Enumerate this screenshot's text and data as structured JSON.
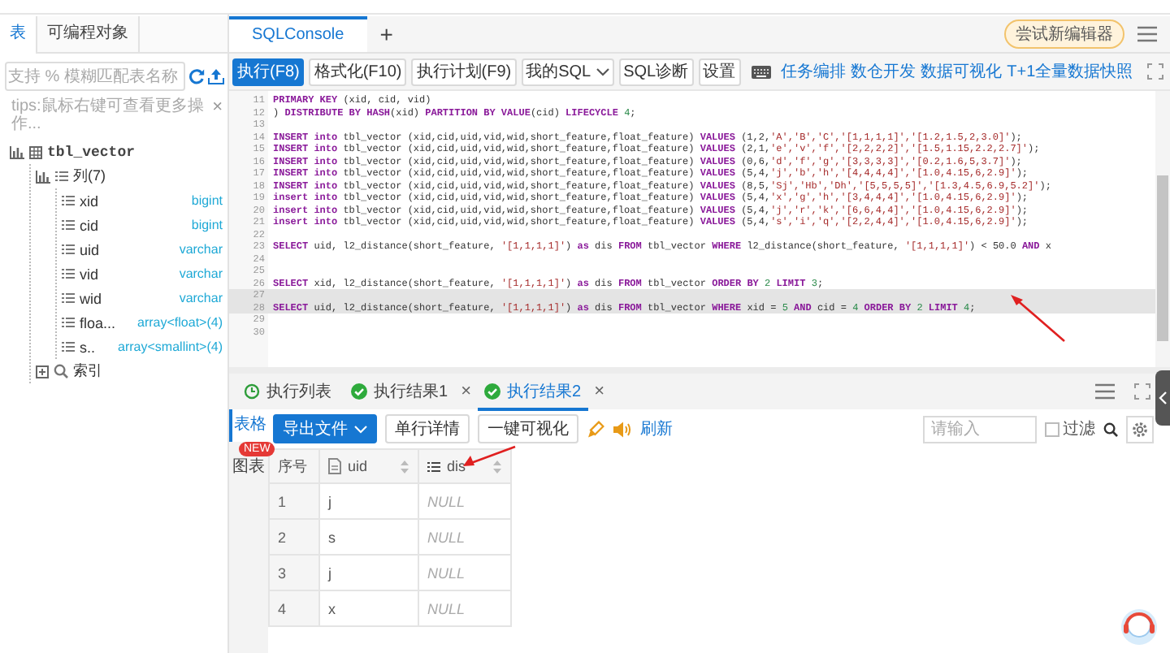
{
  "sidebar": {
    "tabs": [
      {
        "label": "表",
        "selected": true
      },
      {
        "label": "可编程对象",
        "selected": false
      }
    ],
    "search": {
      "placeholder": "支持 % 模糊匹配表名称"
    },
    "tip": "tips:鼠标右键可查看更多操作...",
    "tip_close": "×",
    "tree": [
      {
        "label": "tbl_vector",
        "kind": "table",
        "children": [
          {
            "label": "列(7)",
            "kind": "group",
            "children": [
              {
                "label": "xid",
                "type": "bigint",
                "kind": "column"
              },
              {
                "label": "cid",
                "type": "bigint",
                "kind": "column"
              },
              {
                "label": "uid",
                "type": "varchar",
                "kind": "column"
              },
              {
                "label": "vid",
                "type": "varchar",
                "kind": "column"
              },
              {
                "label": "wid",
                "type": "varchar",
                "kind": "column"
              },
              {
                "label": "floa...",
                "type": "array<float>(4)",
                "kind": "column"
              },
              {
                "label": "s..",
                "type": "array<smallint>(4)",
                "kind": "column"
              }
            ]
          },
          {
            "label": "索引",
            "kind": "index"
          }
        ]
      }
    ]
  },
  "console": {
    "tabs": [
      {
        "label": "SQLConsole",
        "selected": true
      }
    ],
    "add": "+",
    "try_button": "尝试新编辑器",
    "toolbar": [
      {
        "label": "执行(F8)",
        "kind": "primary"
      },
      {
        "label": "格式化(F10)",
        "kind": "button"
      },
      {
        "label": "执行计划(F9)",
        "kind": "button"
      },
      {
        "label": "我的SQL",
        "kind": "dropdown"
      },
      {
        "label": "SQL诊断",
        "kind": "button"
      },
      {
        "label": "设置",
        "kind": "button"
      }
    ],
    "links": [
      "任务编排",
      "数仓开发",
      "数据可视化",
      "T+1全量数据快照"
    ],
    "lines": [
      {
        "number": "11",
        "highlighted": false,
        "tokens": [
          {
            "kind": "keyword",
            "text": "PRIMARY KEY"
          },
          {
            "kind": "plain",
            "text": " (xid, cid, vid)"
          }
        ]
      },
      {
        "number": "12",
        "highlighted": false,
        "tokens": [
          {
            "kind": "plain",
            "text": ") "
          },
          {
            "kind": "keyword",
            "text": "DISTRIBUTE BY HASH"
          },
          {
            "kind": "plain",
            "text": "(xid) "
          },
          {
            "kind": "keyword",
            "text": "PARTITION BY VALUE"
          },
          {
            "kind": "plain",
            "text": "(cid) "
          },
          {
            "kind": "keyword",
            "text": "LIFECYCLE "
          },
          {
            "kind": "number",
            "text": "4"
          },
          {
            "kind": "plain",
            "text": ";"
          }
        ]
      },
      {
        "number": "13",
        "highlighted": false
      },
      {
        "number": "14",
        "highlighted": false,
        "tokens": [
          {
            "kind": "keyword",
            "text": "INSERT into"
          },
          {
            "kind": "plain",
            "text": " tbl_vector (xid,cid,uid,vid,wid,short_feature,float_feature) "
          },
          {
            "kind": "keyword",
            "text": "VALUES"
          },
          {
            "kind": "plain",
            "text": " (1,2,"
          },
          {
            "kind": "string",
            "text": "'A','B','C','[1,1,1,1]','[1.2,1.5,2,3.0]'"
          },
          {
            "kind": "plain",
            "text": ");"
          }
        ]
      },
      {
        "number": "15",
        "highlighted": false,
        "tokens": [
          {
            "kind": "keyword",
            "text": "INSERT into"
          },
          {
            "kind": "plain",
            "text": " tbl_vector (xid,cid,uid,vid,wid,short_feature,float_feature) "
          },
          {
            "kind": "keyword",
            "text": "VALUES"
          },
          {
            "kind": "plain",
            "text": " (2,1,"
          },
          {
            "kind": "string",
            "text": "'e','v','f','[2,2,2,2]','[1.5,1.15,2.2,2.7]'"
          },
          {
            "kind": "plain",
            "text": ");"
          }
        ]
      },
      {
        "number": "16",
        "highlighted": false,
        "tokens": [
          {
            "kind": "keyword",
            "text": "INSERT into"
          },
          {
            "kind": "plain",
            "text": " tbl_vector (xid,cid,uid,vid,wid,short_feature,float_feature) "
          },
          {
            "kind": "keyword",
            "text": "VALUES"
          },
          {
            "kind": "plain",
            "text": " (0,6,"
          },
          {
            "kind": "string",
            "text": "'d','f','g','[3,3,3,3]','[0.2,1.6,5,3.7]'"
          },
          {
            "kind": "plain",
            "text": ");"
          }
        ]
      },
      {
        "number": "17",
        "highlighted": false,
        "tokens": [
          {
            "kind": "keyword",
            "text": "INSERT into"
          },
          {
            "kind": "plain",
            "text": " tbl_vector (xid,cid,uid,vid,wid,short_feature,float_feature) "
          },
          {
            "kind": "keyword",
            "text": "VALUES"
          },
          {
            "kind": "plain",
            "text": " (5,4,"
          },
          {
            "kind": "string",
            "text": "'j','b','h','[4,4,4,4]','[1.0,4.15,6,2.9]'"
          },
          {
            "kind": "plain",
            "text": ");"
          }
        ]
      },
      {
        "number": "18",
        "highlighted": false,
        "tokens": [
          {
            "kind": "keyword",
            "text": "INSERT into"
          },
          {
            "kind": "plain",
            "text": " tbl_vector (xid,cid,uid,vid,wid,short_feature,float_feature) "
          },
          {
            "kind": "keyword",
            "text": "VALUES"
          },
          {
            "kind": "plain",
            "text": " (8,5,"
          },
          {
            "kind": "string",
            "text": "'Sj','Hb','Dh','[5,5,5,5]','[1.3,4.5,6.9,5.2]'"
          },
          {
            "kind": "plain",
            "text": ");"
          }
        ]
      },
      {
        "number": "19",
        "highlighted": false,
        "tokens": [
          {
            "kind": "keyword",
            "text": "insert into"
          },
          {
            "kind": "plain",
            "text": " tbl_vector (xid,cid,uid,vid,wid,short_feature,float_feature) "
          },
          {
            "kind": "keyword",
            "text": "VALUES"
          },
          {
            "kind": "plain",
            "text": " (5,4,"
          },
          {
            "kind": "string",
            "text": "'x','g','h','[3,4,4,4]','[1.0,4.15,6,2.9]'"
          },
          {
            "kind": "plain",
            "text": ");"
          }
        ]
      },
      {
        "number": "20",
        "highlighted": false,
        "tokens": [
          {
            "kind": "keyword",
            "text": "insert into"
          },
          {
            "kind": "plain",
            "text": " tbl_vector (xid,cid,uid,vid,wid,short_feature,float_feature) "
          },
          {
            "kind": "keyword",
            "text": "VALUES"
          },
          {
            "kind": "plain",
            "text": " (5,4,"
          },
          {
            "kind": "string",
            "text": "'j','r','k','[6,6,4,4]','[1.0,4.15,6,2.9]'"
          },
          {
            "kind": "plain",
            "text": ");"
          }
        ]
      },
      {
        "number": "21",
        "highlighted": false,
        "tokens": [
          {
            "kind": "keyword",
            "text": "insert into"
          },
          {
            "kind": "plain",
            "text": " tbl_vector (xid,cid,uid,vid,wid,short_feature,float_feature) "
          },
          {
            "kind": "keyword",
            "text": "VALUES"
          },
          {
            "kind": "plain",
            "text": " (5,4,"
          },
          {
            "kind": "string",
            "text": "'s','i','q','[2,2,4,4]','[1.0,4.15,6,2.9]'"
          },
          {
            "kind": "plain",
            "text": ");"
          }
        ]
      },
      {
        "number": "22",
        "highlighted": false
      },
      {
        "number": "23",
        "highlighted": false,
        "tokens": [
          {
            "kind": "keyword",
            "text": "SELECT"
          },
          {
            "kind": "plain",
            "text": " uid, l2_distance(short_feature, "
          },
          {
            "kind": "string",
            "text": "'[1,1,1,1]'"
          },
          {
            "kind": "plain",
            "text": ") "
          },
          {
            "kind": "keyword",
            "text": "as"
          },
          {
            "kind": "plain",
            "text": " dis "
          },
          {
            "kind": "keyword",
            "text": "FROM"
          },
          {
            "kind": "plain",
            "text": " tbl_vector "
          },
          {
            "kind": "keyword",
            "text": "WHERE"
          },
          {
            "kind": "plain",
            "text": " l2_distance(short_feature, "
          },
          {
            "kind": "string",
            "text": "'[1,1,1,1]'"
          },
          {
            "kind": "plain",
            "text": ") < 50.0 "
          },
          {
            "kind": "keyword",
            "text": "AND"
          },
          {
            "kind": "plain",
            "text": " x"
          }
        ]
      },
      {
        "number": "24",
        "highlighted": false
      },
      {
        "number": "25",
        "highlighted": false
      },
      {
        "number": "26",
        "highlighted": false,
        "tokens": [
          {
            "kind": "keyword",
            "text": "SELECT"
          },
          {
            "kind": "plain",
            "text": " xid, l2_distance(short_feature, "
          },
          {
            "kind": "string",
            "text": "'[1,1,1,1]'"
          },
          {
            "kind": "plain",
            "text": ") "
          },
          {
            "kind": "keyword",
            "text": "as"
          },
          {
            "kind": "plain",
            "text": " dis "
          },
          {
            "kind": "keyword",
            "text": "FROM"
          },
          {
            "kind": "plain",
            "text": " tbl_vector "
          },
          {
            "kind": "keyword",
            "text": "ORDER BY "
          },
          {
            "kind": "number",
            "text": "2"
          },
          {
            "kind": "keyword",
            "text": " LIMIT "
          },
          {
            "kind": "number",
            "text": "3"
          },
          {
            "kind": "plain",
            "text": ";"
          }
        ]
      },
      {
        "number": "27",
        "highlighted": true
      },
      {
        "number": "28",
        "highlighted": true,
        "tokens": [
          {
            "kind": "keyword",
            "text": "SELECT"
          },
          {
            "kind": "plain",
            "text": " uid, l2_distance(short_feature, "
          },
          {
            "kind": "string",
            "text": "'[1,1,1,1]'"
          },
          {
            "kind": "plain",
            "text": ") "
          },
          {
            "kind": "keyword",
            "text": "as"
          },
          {
            "kind": "plain",
            "text": " dis "
          },
          {
            "kind": "keyword",
            "text": "FROM"
          },
          {
            "kind": "plain",
            "text": " tbl_vector "
          },
          {
            "kind": "keyword",
            "text": "WHERE"
          },
          {
            "kind": "plain",
            "text": " xid = "
          },
          {
            "kind": "number",
            "text": "5"
          },
          {
            "kind": "keyword",
            "text": " AND "
          },
          {
            "kind": "plain",
            "text": "cid = "
          },
          {
            "kind": "number",
            "text": "4"
          },
          {
            "kind": "keyword",
            "text": " ORDER BY "
          },
          {
            "kind": "number",
            "text": "2"
          },
          {
            "kind": "keyword",
            "text": " LIMIT "
          },
          {
            "kind": "number",
            "text": "4"
          },
          {
            "kind": "plain",
            "text": ";"
          }
        ]
      },
      {
        "number": "29",
        "highlighted": false
      },
      {
        "number": "30",
        "highlighted": false
      }
    ]
  },
  "results": {
    "tabs": [
      {
        "label": "执行列表",
        "kind": "history",
        "selected": false
      },
      {
        "label": "执行结果1",
        "kind": "result",
        "selected": false,
        "close": "×"
      },
      {
        "label": "执行结果2",
        "kind": "result",
        "selected": true,
        "close": "×"
      }
    ],
    "views": [
      {
        "label": "表格",
        "selected": true
      },
      {
        "label": "图表",
        "selected": false,
        "badge": "NEW"
      }
    ],
    "actions": [
      {
        "label": "导出文件",
        "kind": "primary"
      },
      {
        "label": "单行详情",
        "kind": "button"
      },
      {
        "label": "一键可视化",
        "kind": "button"
      }
    ],
    "refresh": "刷新",
    "filter": {
      "placeholder": "请输入",
      "checkbox": {
        "label": "过滤",
        "checked": false
      }
    },
    "table": {
      "columns": [
        {
          "label": "序号",
          "kind": "index"
        },
        {
          "label": "uid",
          "kind": "text"
        },
        {
          "label": "dis",
          "kind": "list"
        }
      ],
      "rows": [
        {
          "cells": [
            {
              "text": "1",
              "is_null": false
            },
            {
              "text": "j",
              "is_null": false
            },
            {
              "text": "NULL",
              "is_null": true
            }
          ]
        },
        {
          "cells": [
            {
              "text": "2",
              "is_null": false
            },
            {
              "text": "s",
              "is_null": false
            },
            {
              "text": "NULL",
              "is_null": true
            }
          ]
        },
        {
          "cells": [
            {
              "text": "3",
              "is_null": false
            },
            {
              "text": "j",
              "is_null": false
            },
            {
              "text": "NULL",
              "is_null": true
            }
          ]
        },
        {
          "cells": [
            {
              "text": "4",
              "is_null": false
            },
            {
              "text": "x",
              "is_null": false
            },
            {
              "text": "NULL",
              "is_null": true
            }
          ]
        }
      ]
    }
  }
}
